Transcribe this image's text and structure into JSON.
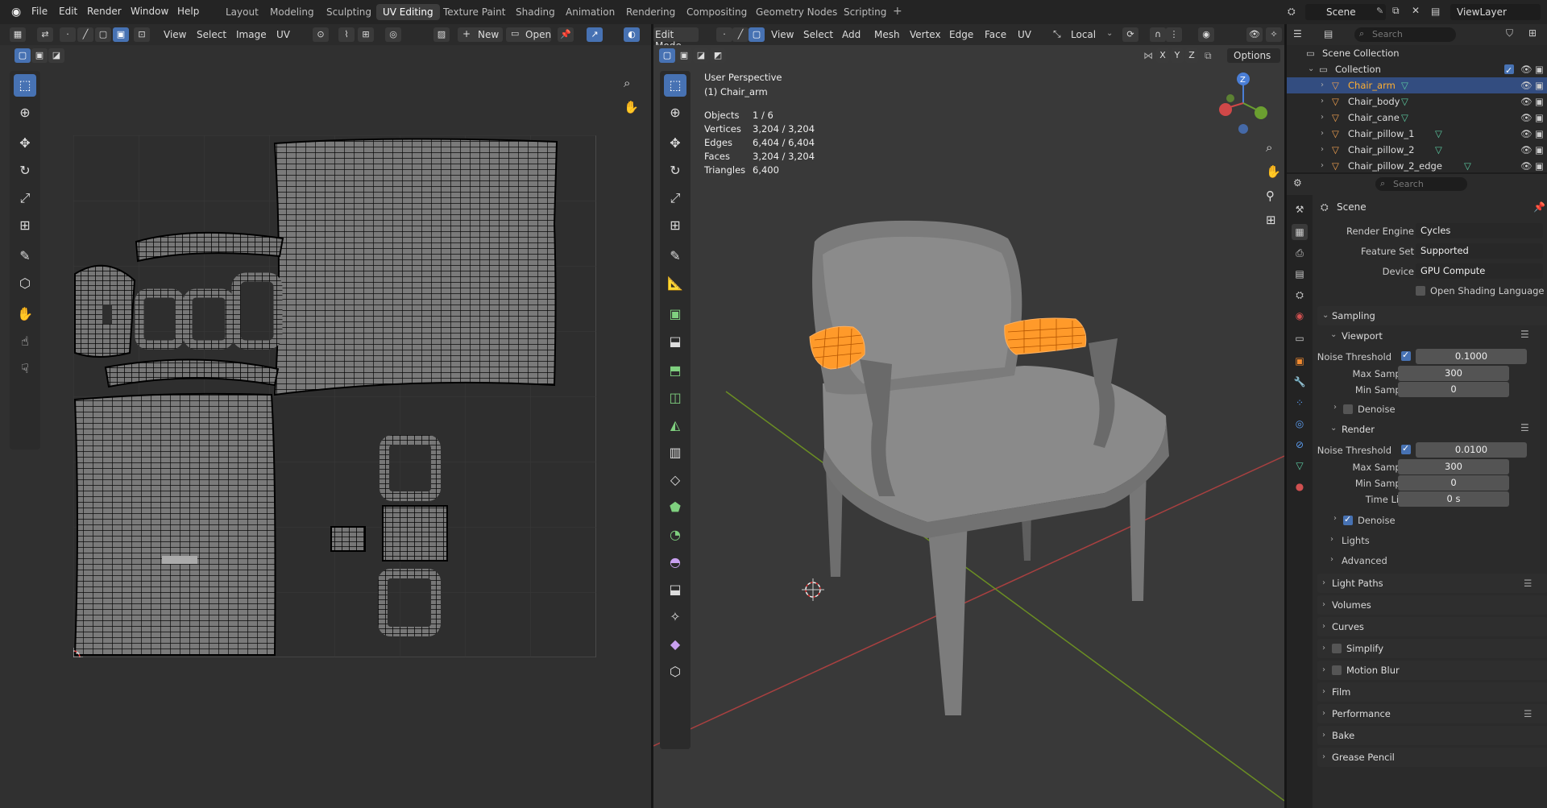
{
  "app": {
    "menus": [
      "File",
      "Edit",
      "Render",
      "Window",
      "Help"
    ],
    "workspaces": [
      "Layout",
      "Modeling",
      "Sculpting",
      "UV Editing",
      "Texture Paint",
      "Shading",
      "Animation",
      "Rendering",
      "Compositing",
      "Geometry Nodes",
      "Scripting"
    ],
    "active_workspace": "UV Editing",
    "scene": "Scene",
    "view_layer": "ViewLayer"
  },
  "uv_editor": {
    "menus": [
      "View",
      "Select",
      "Image",
      "UV"
    ],
    "new_label": "New",
    "open_label": "Open"
  },
  "viewport": {
    "mode": "Edit Mode",
    "menus": [
      "View",
      "Select",
      "Add",
      "Mesh",
      "Vertex",
      "Edge",
      "Face",
      "UV"
    ],
    "orientation": "Local",
    "options_label": "Options",
    "axes": [
      "X",
      "Y",
      "Z"
    ],
    "perspective": "User Perspective",
    "object_label": "(1) Chair_arm",
    "stats": [
      {
        "k": "Objects",
        "v": "1 / 6"
      },
      {
        "k": "Vertices",
        "v": "3,204 / 3,204"
      },
      {
        "k": "Edges",
        "v": "6,404 / 6,404"
      },
      {
        "k": "Faces",
        "v": "3,204 / 3,204"
      },
      {
        "k": "Triangles",
        "v": "6,400"
      }
    ]
  },
  "outliner": {
    "search_placeholder": "Search",
    "root": "Scene Collection",
    "collection": "Collection",
    "items": [
      "Chair_arm",
      "Chair_body",
      "Chair_cane",
      "Chair_pillow_1",
      "Chair_pillow_2",
      "Chair_pillow_2_edge"
    ]
  },
  "properties": {
    "search_placeholder": "Search",
    "context": "Scene",
    "render_engine_label": "Render Engine",
    "render_engine": "Cycles",
    "feature_set_label": "Feature Set",
    "feature_set": "Supported",
    "device_label": "Device",
    "device": "GPU Compute",
    "osl_label": "Open Shading Language",
    "sampling": "Sampling",
    "viewport_label": "Viewport",
    "noise_threshold_label": "Noise Threshold",
    "vp_noise": "0.1000",
    "max_samples_label": "Max Samples",
    "vp_max": "300",
    "min_samples_label": "Min Samples",
    "vp_min": "0",
    "denoise_label": "Denoise",
    "render_label": "Render",
    "r_noise": "0.0100",
    "r_max": "300",
    "r_min": "0",
    "time_limit_label": "Time Limit",
    "r_time": "0 s",
    "lights": "Lights",
    "advanced": "Advanced",
    "sections": [
      "Light Paths",
      "Volumes",
      "Curves",
      "Simplify",
      "Motion Blur",
      "Film",
      "Performance",
      "Bake",
      "Grease Pencil"
    ]
  },
  "colors": {
    "accent": "#4772b3",
    "selection": "#ff8c1a"
  }
}
